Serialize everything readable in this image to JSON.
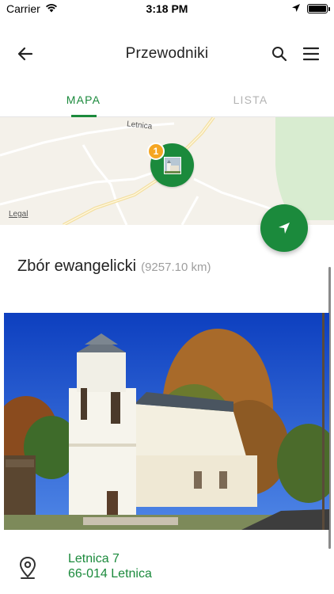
{
  "status_bar": {
    "carrier": "Carrier",
    "time": "3:18 PM"
  },
  "header": {
    "title": "Przewodniki"
  },
  "tabs": [
    {
      "label": "MAPA",
      "active": true
    },
    {
      "label": "LISTA",
      "active": false
    }
  ],
  "map": {
    "road_label": "Letnica",
    "legal": "Legal",
    "marker_count": "1"
  },
  "place": {
    "title": "Zbór ewangelicki",
    "distance": "(9257.10 km)"
  },
  "address": {
    "line1": "Letnica 7",
    "line2": "66-014 Letnica"
  },
  "colors": {
    "accent": "#1b8a3c",
    "badge": "#f5a623",
    "inactive_tab": "#b3b3b3"
  },
  "icons": [
    "wifi-icon",
    "location-arrow-icon",
    "battery-icon",
    "back-arrow-icon",
    "search-icon",
    "menu-icon",
    "navigate-icon",
    "map-pin-icon"
  ]
}
